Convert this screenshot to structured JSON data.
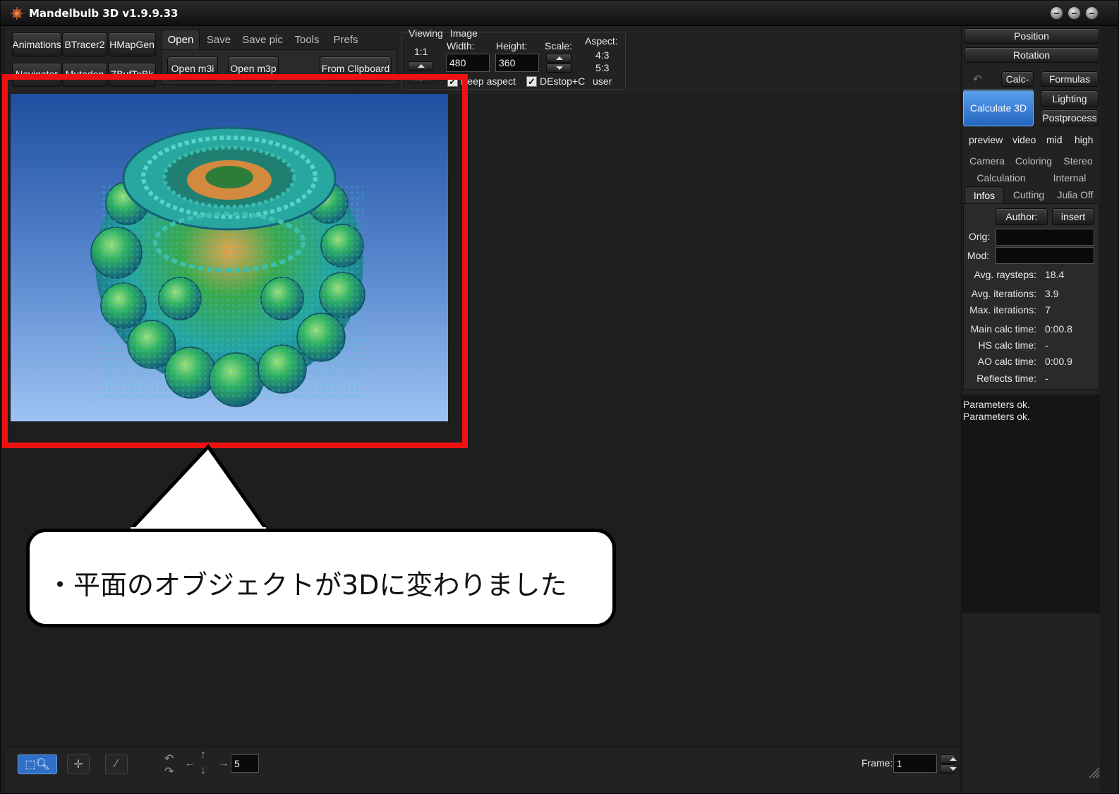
{
  "window": {
    "title": "Mandelbulb 3D   v1.9.9.33"
  },
  "toolbar": {
    "left_buttons_row1": [
      "Animations",
      "BTracer2",
      "HMapGen"
    ],
    "left_buttons_row2": [
      "Navigator",
      "Mutaden",
      "ZBufToBk"
    ],
    "tabs": [
      "Open",
      "Save",
      "Save pic",
      "Tools",
      "Prefs"
    ],
    "open_buttons": [
      "Open m3i",
      "Open m3p",
      "From Clipboard"
    ],
    "viewing_label": "Viewing",
    "viewing_ratio": "1:1",
    "image_label": "Image",
    "width_label": "Width:",
    "width_value": "480",
    "height_label": "Height:",
    "height_value": "360",
    "scale_label": "Scale:",
    "aspect_label": "Aspect:",
    "aspect_options": [
      "4:3",
      "5:3",
      "user"
    ],
    "keep_aspect_label": "Keep aspect",
    "destop_label": "DEstop+C"
  },
  "right_panel": {
    "position_btn": "Position",
    "rotation_btn": "Rotation",
    "calc_btn": "Calc-",
    "formulas_btn": "Formulas",
    "calculate3d_btn": "Calculate 3D",
    "lighting_btn": "Lighting",
    "postprocess_btn": "Postprocess",
    "quality": [
      "preview",
      "video",
      "mid",
      "high"
    ],
    "tabs_row1": [
      "Camera",
      "Coloring",
      "Stereo"
    ],
    "tabs_row2": [
      "Calculation",
      "Internal"
    ],
    "tabs_row3": [
      "Infos",
      "Cutting",
      "Julia Off"
    ],
    "author_btn": "Author:",
    "insert_btn": "insert",
    "orig_label": "Orig:",
    "mod_label": "Mod:",
    "infos": [
      {
        "key": "Avg. raysteps:",
        "val": "18.4"
      },
      {
        "key": "Avg. iterations:",
        "val": "3.9"
      },
      {
        "key": "Max. iterations:",
        "val": "7"
      },
      {
        "key": "Main calc time:",
        "val": "0:00.8"
      },
      {
        "key": "HS calc time:",
        "val": "-"
      },
      {
        "key": "AO calc time:",
        "val": "0:00.9"
      },
      {
        "key": "Reflects time:",
        "val": "-"
      }
    ],
    "log_lines": [
      "Parameters ok.",
      "Parameters ok."
    ]
  },
  "bottom": {
    "step_value": "5",
    "frame_label": "Frame:",
    "frame_value": "1"
  },
  "callout": {
    "text": "・平面のオブジェクトが3Dに変わりました"
  },
  "colors": {
    "highlight": "#ee1111",
    "accent_blue": "#2f6fc8"
  }
}
